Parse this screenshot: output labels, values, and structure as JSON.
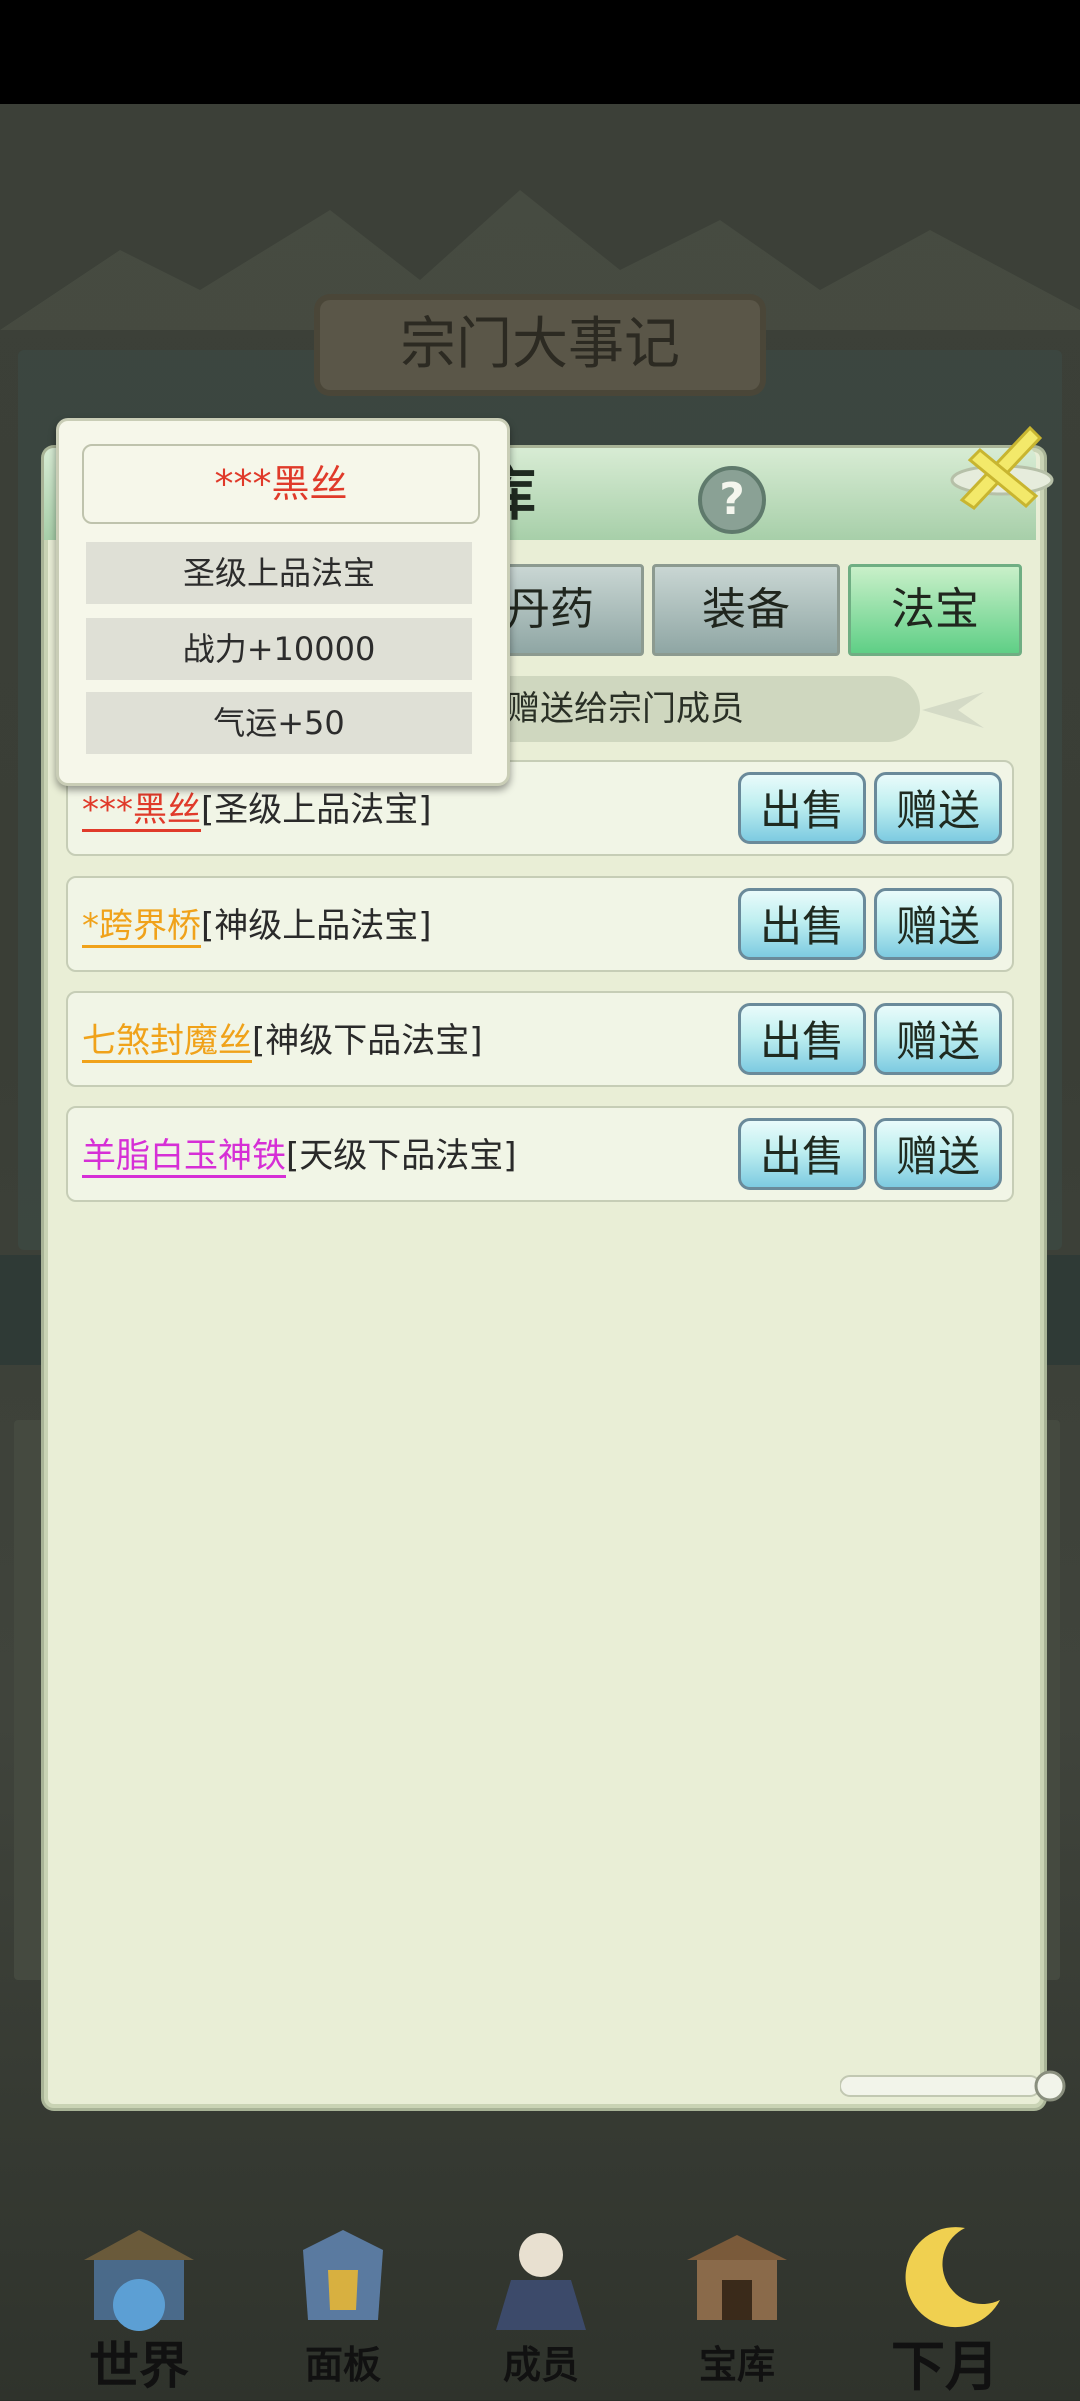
{
  "background": {
    "title": "宗门大事记"
  },
  "dialog": {
    "title": "宝库",
    "help_icon": "?",
    "tabs": [
      {
        "label": "丹药",
        "active": false
      },
      {
        "label": "装备",
        "active": false
      },
      {
        "label": "法宝",
        "active": true
      }
    ],
    "hint": "赠送给宗门成员",
    "items": [
      {
        "prefix": "***",
        "name": "黑丝",
        "grade": "[圣级上品法宝]",
        "color": "#e03a2a",
        "sell": "出售",
        "gift": "赠送"
      },
      {
        "prefix": "*",
        "name": "跨界桥",
        "grade": "[神级上品法宝]",
        "color": "#f0a21a",
        "sell": "出售",
        "gift": "赠送"
      },
      {
        "prefix": "",
        "name": "七煞封魔丝",
        "grade": "[神级下品法宝]",
        "color": "#f0a21a",
        "sell": "出售",
        "gift": "赠送"
      },
      {
        "prefix": "",
        "name": "羊脂白玉神铁",
        "grade": "[天级下品法宝]",
        "color": "#d62fd6",
        "sell": "出售",
        "gift": "赠送"
      }
    ]
  },
  "tooltip": {
    "name_prefix": "***",
    "name": "黑丝",
    "name_color": "#e03a2a",
    "lines": [
      "圣级上品法宝",
      "战力+10000",
      "气运+50"
    ]
  },
  "bottom_nav": [
    {
      "label": "世界",
      "icon": "palace-icon"
    },
    {
      "label": "面板",
      "icon": "armor-icon"
    },
    {
      "label": "成员",
      "icon": "disciple-icon"
    },
    {
      "label": "宝库",
      "icon": "treasury-icon"
    },
    {
      "label": "下月",
      "icon": "moon-icon"
    }
  ]
}
